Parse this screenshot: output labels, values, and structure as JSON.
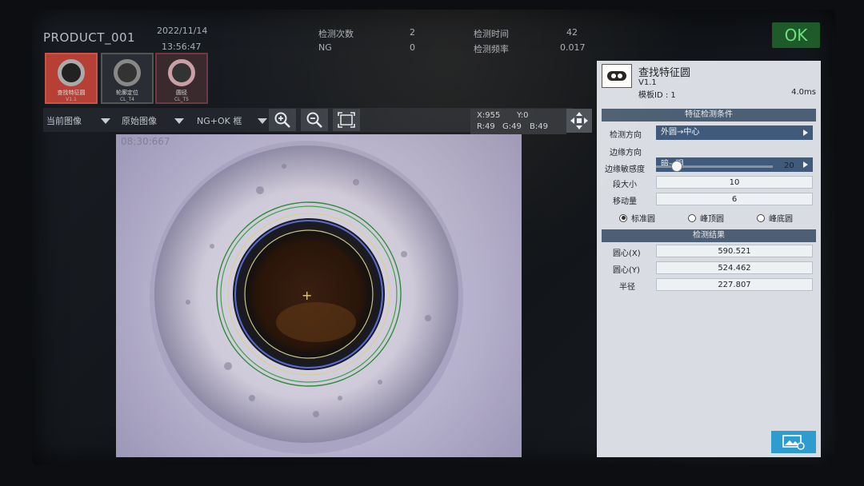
{
  "header": {
    "product": "PRODUCT_001",
    "date": "2022/11/14",
    "time": "13:56:47",
    "detect_count_label": "检测次数",
    "detect_count": "2",
    "ng_label": "NG",
    "ng_count": "0",
    "detect_time_label": "检测时间",
    "detect_time": "42",
    "detect_freq_label": "检测频率",
    "detect_freq": "0.017",
    "result": "OK"
  },
  "thumbs": [
    {
      "label": "查找特征圆",
      "sub": "V1.1",
      "active": true
    },
    {
      "label": "轮廓定位",
      "sub": "CL_T4",
      "active": false
    },
    {
      "label": "圆径",
      "sub": "CL_T5",
      "active": false
    }
  ],
  "toolbar": {
    "current_image": "当前图像",
    "original_image": "原始图像",
    "ng_ok_frame": "NG+OK 框",
    "zoom_in": "zoom-in-icon",
    "zoom_out": "zoom-out-icon",
    "fit": "fit-screen-icon",
    "move": "move-arrows-icon"
  },
  "readout": {
    "x": "X:955",
    "y": "Y:0",
    "r": "R:49",
    "g": "G:49",
    "b": "B:49"
  },
  "viewer": {
    "timestamp": "08:30:667",
    "crosshair": "+"
  },
  "panel": {
    "tool_name": "查找特征圆",
    "version": "V1.1",
    "template_id": "模板ID : 1",
    "elapsed": "4.0ms",
    "conditions_title": "特征检测条件",
    "direction_label": "检测方向",
    "direction_value": "外圆→中心",
    "edge_label": "边缘方向",
    "edge_value": "暗→明",
    "sensitivity_label": "边缘敏感度",
    "sensitivity_value": "20",
    "sensitivity_fraction": 0.18,
    "segment_label": "段大小",
    "segment_value": "10",
    "move_label": "移动量",
    "move_value": "6",
    "radio_standard": "标准圆",
    "radio_peak": "峰顶圆",
    "radio_bottom": "峰底圆",
    "results_title": "检测结果",
    "cx_label": "圆心(X)",
    "cx_value": "590.521",
    "cy_label": "圆心(Y)",
    "cy_value": "524.462",
    "radius_label": "半径",
    "radius_value": "227.807"
  }
}
